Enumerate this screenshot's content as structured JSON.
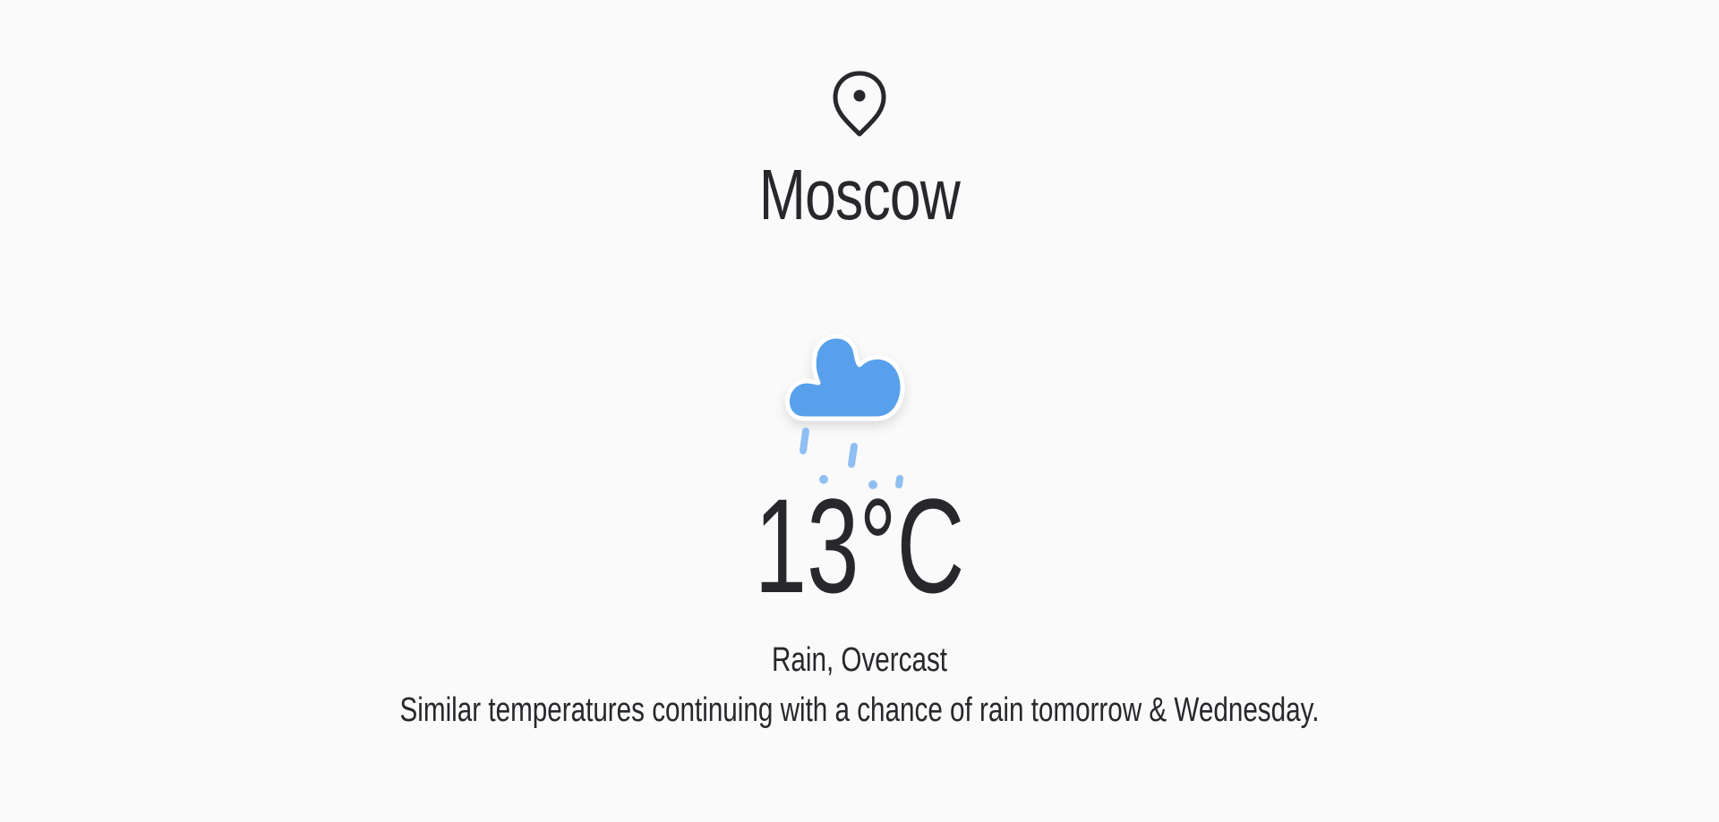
{
  "location": {
    "city": "Moscow",
    "icon": "map-pin-icon"
  },
  "weather": {
    "icon": "rain-cloud-icon",
    "temperature": "13°C",
    "condition": "Rain, Overcast",
    "forecast": "Similar temperatures continuing with a chance of rain tomorrow & Wednesday."
  },
  "colors": {
    "background": "#fafafa",
    "text": "#27272c",
    "cloud": "#58a0eb",
    "rain": "#8fbff2"
  }
}
